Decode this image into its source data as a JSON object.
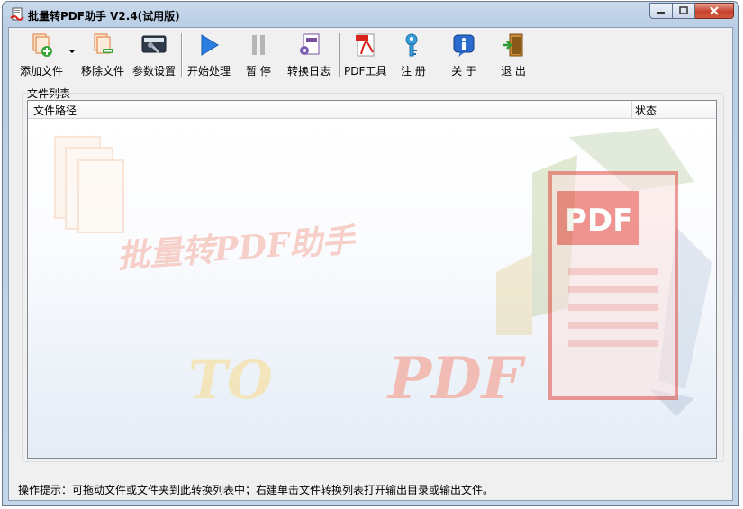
{
  "window": {
    "title": "批量转PDF助手 V2.4(试用版)"
  },
  "toolbar": {
    "add_file": "添加文件",
    "remove_file": "移除文件",
    "settings": "参数设置",
    "start": "开始处理",
    "pause": "暂 停",
    "log": "转换日志",
    "pdf_tools": "PDF工具",
    "register": "注 册",
    "about": "关 于",
    "exit": "退 出"
  },
  "file_list": {
    "group_label": "文件列表",
    "columns": [
      "文件路径",
      "状态"
    ],
    "rows": [],
    "watermark_title": "批量转PDF助手",
    "watermark_to": "TO",
    "watermark_pdf": "PDF"
  },
  "status_bar": {
    "hint": "操作提示：可拖动文件或文件夹到此转换列表中；右建单击文件转换列表打开输出目录或输出文件。"
  },
  "colors": {
    "accent_blue": "#1f6fd6",
    "pdf_red": "#d9231c",
    "watermark_red": "#f2b9b0",
    "watermark_yellow": "#f5e6b8",
    "title_bar": "#c9d9ec"
  },
  "icons": {
    "app": "pdf-app-icon",
    "add_file": "add-file-icon",
    "remove_file": "remove-file-icon",
    "settings": "settings-icon",
    "start": "play-icon",
    "pause": "pause-icon",
    "log": "log-icon",
    "pdf_tools": "pdf-tools-icon",
    "register": "key-icon",
    "about": "info-icon",
    "exit": "exit-door-icon"
  }
}
